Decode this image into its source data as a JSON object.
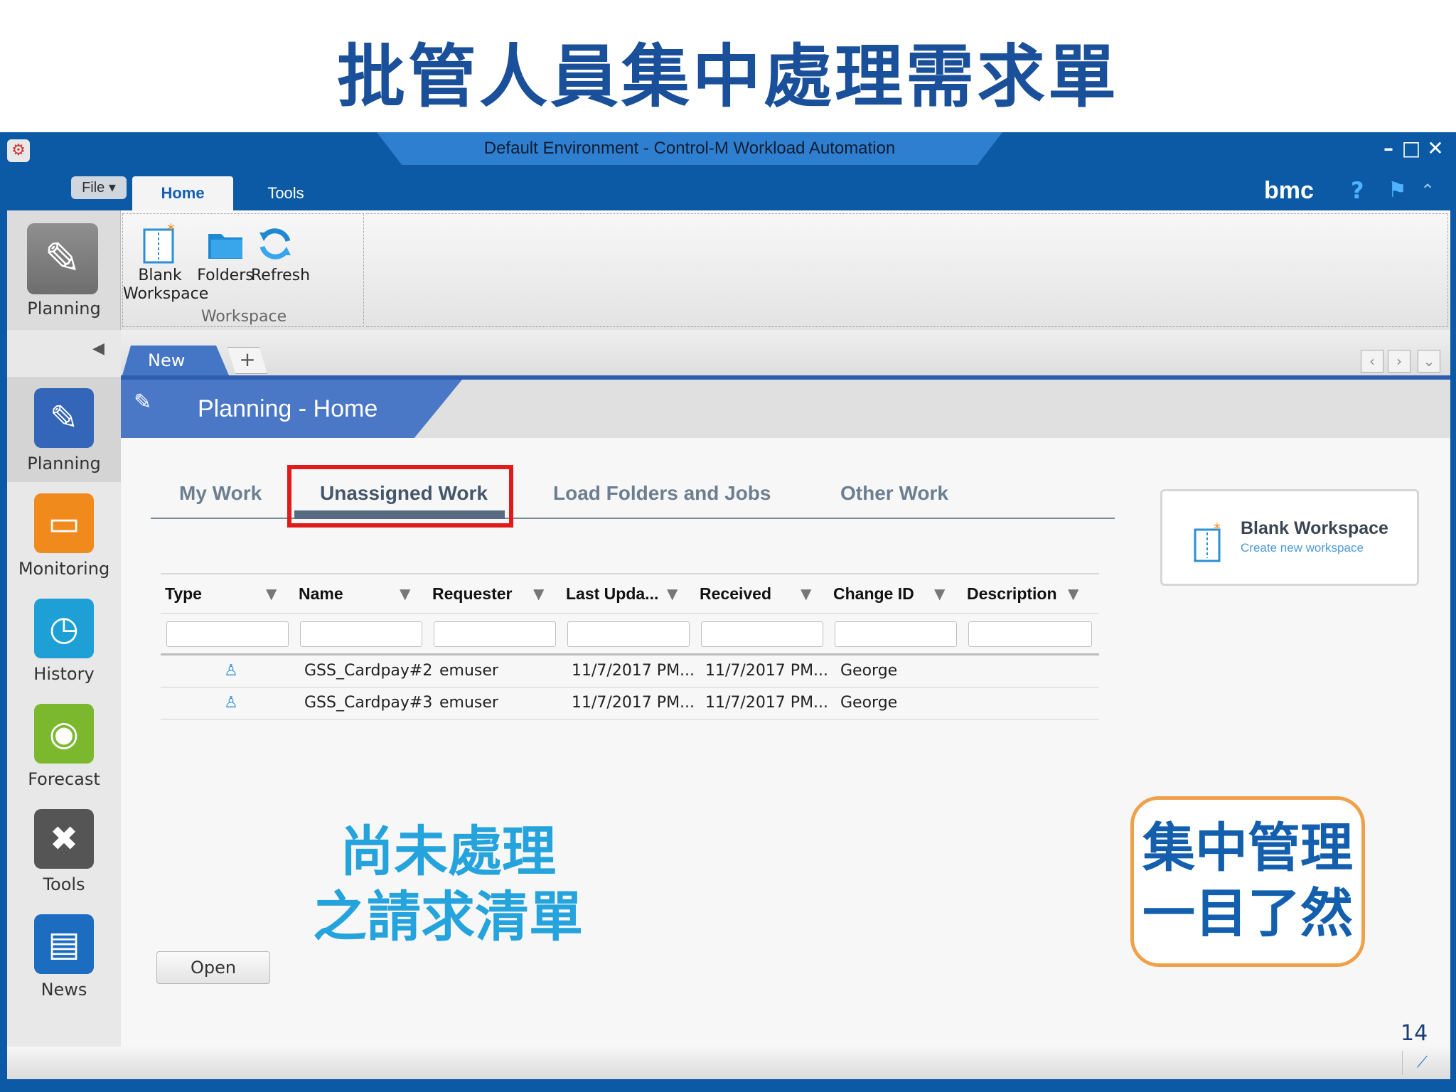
{
  "slide": {
    "title": "批管人員集中處理需求單",
    "page_number": "14"
  },
  "window": {
    "title": "Default Environment - Control-M Workload Automation",
    "controls": [
      "minimize-icon",
      "maximize-icon",
      "close-icon"
    ]
  },
  "ribbon_tabs": {
    "file_label": "File ▾",
    "home_label": "Home",
    "tools_label": "Tools",
    "brand": "bmc"
  },
  "ribbon": {
    "planning_label": "Planning",
    "group_label": "Workspace",
    "buttons": [
      {
        "label_line1": "Blank",
        "label_line2": "Workspace",
        "icon": "blank-workspace-icon"
      },
      {
        "label_line1": "Folders",
        "label_line2": "",
        "icon": "folders-icon"
      },
      {
        "label_line1": "Refresh",
        "label_line2": "",
        "icon": "refresh-icon"
      }
    ]
  },
  "nav": {
    "items": [
      {
        "label": "Planning",
        "icon": "pencil-icon",
        "color": "#3366b8"
      },
      {
        "label": "Monitoring",
        "icon": "monitor-icon",
        "color": "#f08a1c"
      },
      {
        "label": "History",
        "icon": "history-icon",
        "color": "#1ea0d6"
      },
      {
        "label": "Forecast",
        "icon": "forecast-icon",
        "color": "#7bb82e"
      },
      {
        "label": "Tools",
        "icon": "tools-icon",
        "color": "#555555"
      },
      {
        "label": "News",
        "icon": "news-icon",
        "color": "#1c6cc0"
      }
    ]
  },
  "doc_tabs": {
    "active_label": "New",
    "add_label": "+"
  },
  "planning_header": {
    "title": "Planning - Home"
  },
  "inner_tabs": [
    {
      "label": "My Work"
    },
    {
      "label": "Unassigned Work",
      "selected": true
    },
    {
      "label": "Load Folders and Jobs"
    },
    {
      "label": "Other Work"
    }
  ],
  "grid": {
    "columns": [
      "Type",
      "Name",
      "Requester",
      "Last Upda...",
      "Received",
      "Change ID",
      "Description"
    ],
    "rows": [
      {
        "type_icon": "user-icon",
        "name": "GSS_Cardpay#2",
        "requester": "emuser",
        "last_updated": "11/7/2017 PM...",
        "received": "11/7/2017 PM...",
        "change_id": "George",
        "description": ""
      },
      {
        "type_icon": "user-icon",
        "name": "GSS_Cardpay#3",
        "requester": "emuser",
        "last_updated": "11/7/2017 PM...",
        "received": "11/7/2017 PM...",
        "change_id": "George",
        "description": ""
      }
    ]
  },
  "blank_card": {
    "title": "Blank Workspace",
    "subtitle": "Create new workspace"
  },
  "annotations": {
    "left_line1": "尚未處理",
    "left_line2": "之請求清單",
    "right_line1": "集中管理",
    "right_line2": "一目了然"
  },
  "actions": {
    "open_label": "Open"
  },
  "colors": {
    "window_blue": "#0c5aa6",
    "header_blue": "#4a78c6",
    "highlight_red": "#e21a1a",
    "annotation_cyan": "#25a3dc",
    "annotation_orange_border": "#f0a048",
    "title_navy": "#1a4f9a"
  }
}
